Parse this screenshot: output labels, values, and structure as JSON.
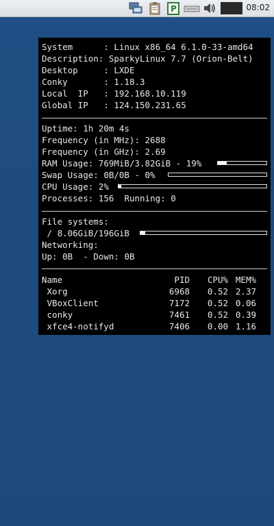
{
  "panel": {
    "clock": "08:02",
    "icons": [
      "network-icon",
      "clipboard-icon",
      "package-updater-icon",
      "keyboard-icon",
      "volume-icon"
    ],
    "updater_letter": "P"
  },
  "conky": {
    "system": [
      {
        "label": "System     ",
        "value": "Linux x86_64 6.1.0-33-amd64"
      },
      {
        "label": "Description",
        "value": "SparkyLinux 7.7 (Orion-Belt)"
      },
      {
        "label": "Desktop    ",
        "value": "LXDE"
      },
      {
        "label": "Conky      ",
        "value": "1.18.3"
      },
      {
        "label": "Local  IP  ",
        "value": "192.168.10.119"
      },
      {
        "label": "Global IP  ",
        "value": "124.150.231.65"
      }
    ],
    "uptime_label": "Uptime:",
    "uptime": "1h 20m 4s",
    "freq_mhz_label": "Frequency (in MHz):",
    "freq_mhz": "2688",
    "freq_ghz_label": "Frequency (in GHz):",
    "freq_ghz": "2.69",
    "ram_label": "RAM Usage:",
    "ram": "769MiB/3.82GiB - 19%",
    "ram_percent": 19,
    "swap_label": "Swap Usage:",
    "swap": "0B/0B - 0%",
    "swap_percent": 0,
    "cpu_label": "CPU Usage:",
    "cpu": "2%",
    "cpu_percent": 2,
    "processes_label": "Processes:",
    "processes": "156",
    "running_label": "Running:",
    "running": "0",
    "fs_label": "File systems:",
    "fs_root": " / 8.06GiB/196GiB",
    "fs_percent": 4,
    "net_label": "Networking:",
    "net_up_label": "Up:",
    "net_up": "0B",
    "net_down_label": "- Down:",
    "net_down": "0B",
    "proc_headers": {
      "name": "Name",
      "pid": "PID",
      "cpu": "CPU%",
      "mem": "MEM%"
    },
    "procs": [
      {
        "name": " Xorg",
        "pid": "6968",
        "cpu": "0.52",
        "mem": "2.37"
      },
      {
        "name": " VBoxClient",
        "pid": "7172",
        "cpu": "0.52",
        "mem": "0.06"
      },
      {
        "name": " conky",
        "pid": "7461",
        "cpu": "0.52",
        "mem": "0.39"
      },
      {
        "name": " xfce4-notifyd",
        "pid": "7406",
        "cpu": "0.00",
        "mem": "1.16"
      }
    ]
  }
}
